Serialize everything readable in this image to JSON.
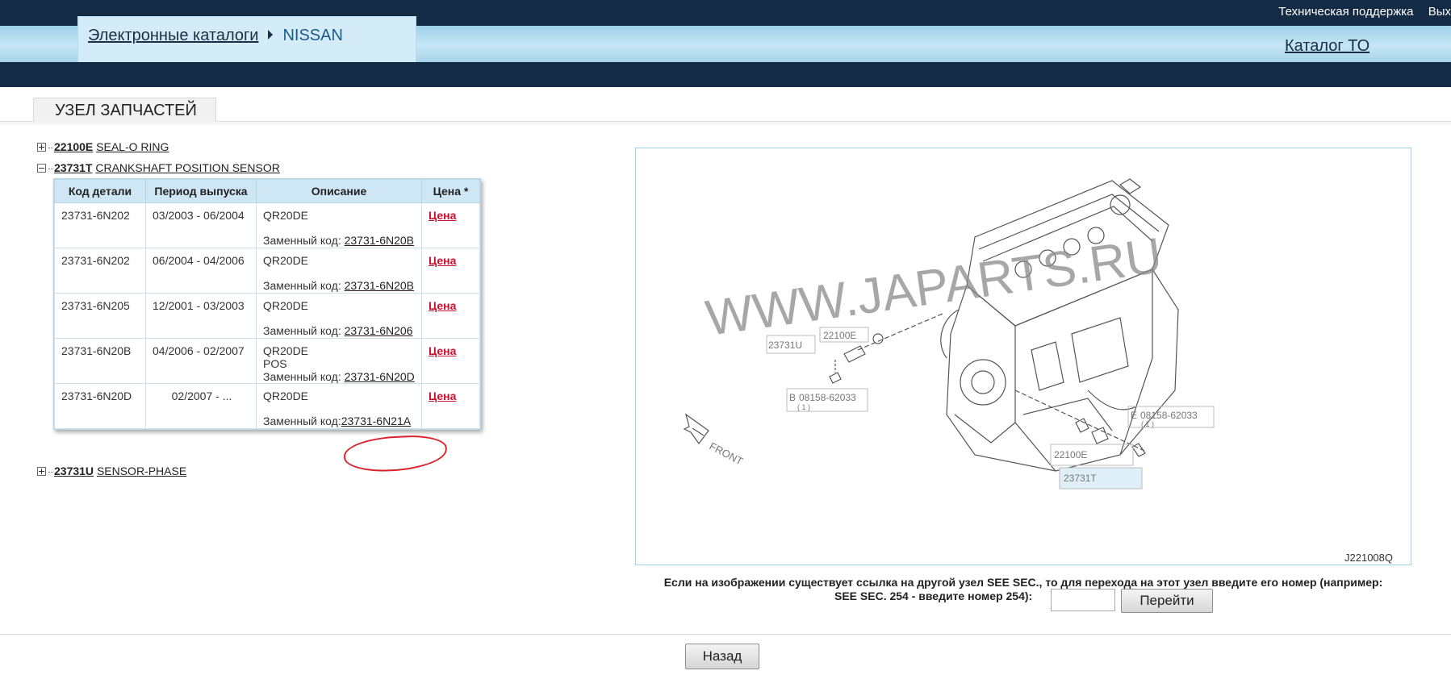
{
  "header": {
    "breadcrumb": [
      "Электронные каталоги",
      "NISSAN"
    ],
    "top_links": [
      "Техническая поддержка",
      "Вых"
    ],
    "catalog_to": "Каталог ТО"
  },
  "section_tab": "УЗЕЛ ЗАПЧАСТЕЙ",
  "tree": [
    {
      "code": "22100E",
      "name": "SEAL-O RING",
      "expanded": false
    },
    {
      "code": "23731T",
      "name": "CRANKSHAFT POSITION SENSOR",
      "expanded": true
    },
    {
      "code": "23731U",
      "name": "SENSOR-PHASE",
      "expanded": false
    }
  ],
  "parts_table": {
    "headers": [
      "Код детали",
      "Период выпуска",
      "Описание",
      "Цена *"
    ],
    "rows": [
      {
        "code": "23731-6N202",
        "period": "03/2003 - 06/2004",
        "desc": "QR20DE",
        "desc2": "",
        "replaced_label": "Заменный код: ",
        "replaced": "23731-6N20B",
        "price": "Цена"
      },
      {
        "code": "23731-6N202",
        "period": "06/2004 - 04/2006",
        "desc": "QR20DE",
        "desc2": "",
        "replaced_label": "Заменный код: ",
        "replaced": "23731-6N20B",
        "price": "Цена"
      },
      {
        "code": "23731-6N205",
        "period": "12/2001 - 03/2003",
        "desc": "QR20DE",
        "desc2": "",
        "replaced_label": "Заменный код: ",
        "replaced": "23731-6N206",
        "price": "Цена"
      },
      {
        "code": "23731-6N20B",
        "period": "04/2006 - 02/2007",
        "desc": "QR20DE",
        "desc2": "POS",
        "replaced_label": "Заменный код: ",
        "replaced": "23731-6N20D",
        "price": "Цена"
      },
      {
        "code": "23731-6N20D",
        "period": "02/2007 - ...",
        "desc": "QR20DE",
        "desc2": "",
        "replaced_label": "Заменный код:",
        "replaced": "23731-6N21A",
        "price": "Цена"
      }
    ]
  },
  "diagram": {
    "watermark": "WWW.JAPARTS.RU",
    "labels": {
      "part_a": "23731U",
      "part_b": "22100E",
      "bolt_left": "08158-62033",
      "bolt_left_qty": "( 1 )",
      "bolt_right": "08158-62033",
      "bolt_right_qty": "( 1 )",
      "part_c": "22100E",
      "part_d": "23731T",
      "marker_b": "B",
      "marker_e": "E",
      "front": "FRONT",
      "figure_id": "J221008Q"
    }
  },
  "section_hint": {
    "line1": "Если на изображении существует ссылка на другой узел SEE SEC., то для перехода на этот узел введите его номер (например:",
    "line2": "SEE SEC. 254 - введите номер 254):",
    "go_label": "Перейти"
  },
  "back_label": "Назад",
  "colors": {
    "header_dark": "#152a44",
    "price_red": "#c8102e",
    "annotation_red": "#d9232a"
  }
}
